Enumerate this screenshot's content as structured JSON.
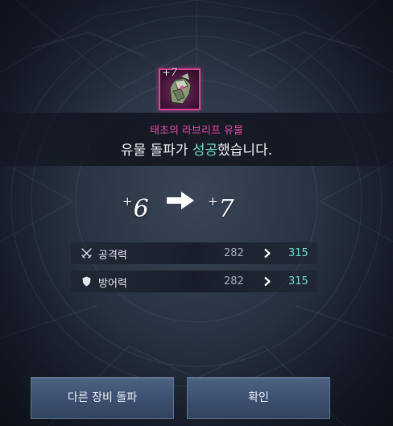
{
  "item": {
    "level_label": "+7",
    "name": "태초의 라브리프 유물",
    "icon": "relic-gauntlet-icon",
    "rarity_color": "#e0409a"
  },
  "result": {
    "prefix": "유물 돌파가 ",
    "highlight": "성공",
    "suffix": "했습니다.",
    "highlight_color": "#6fe0c4"
  },
  "level_change": {
    "before": "6",
    "after": "7",
    "plus_sign": "+",
    "arrow_icon": "right-arrow-icon"
  },
  "stats": [
    {
      "icon": "crossed-swords-icon",
      "label": "공격력",
      "before": "282",
      "after": "315"
    },
    {
      "icon": "shield-icon",
      "label": "방어력",
      "before": "282",
      "after": "315"
    }
  ],
  "buttons": {
    "other": "다른 장비 돌파",
    "confirm": "확인"
  }
}
